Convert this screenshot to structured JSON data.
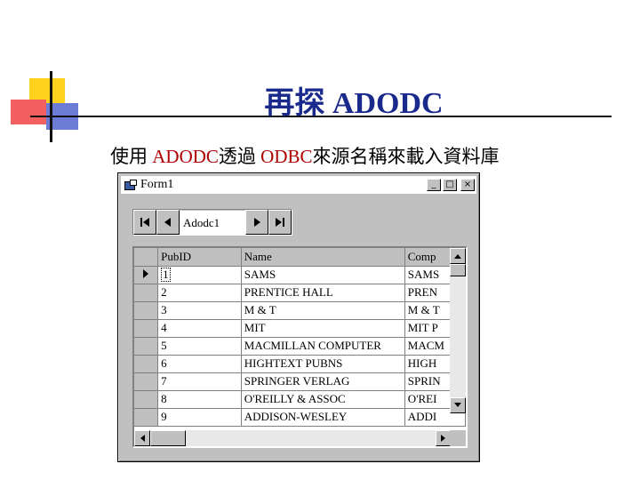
{
  "slide": {
    "title": "再探 ADODC",
    "subtitle_parts": [
      "使用 ",
      "ADODC",
      "透過 ",
      "ODBC",
      "來源名稱來載入資料庫"
    ]
  },
  "window": {
    "title": "Form1",
    "buttons": {
      "minimize": "_",
      "maximize": "□",
      "close": "×"
    }
  },
  "adodc": {
    "caption": "Adodc1"
  },
  "grid": {
    "columns": [
      "PubID",
      "Name",
      "Comp"
    ],
    "current_row": 0,
    "rows": [
      {
        "pubid": "1",
        "name": "SAMS",
        "comp": "SAMS"
      },
      {
        "pubid": "2",
        "name": "PRENTICE HALL",
        "comp": "PREN"
      },
      {
        "pubid": "3",
        "name": "M & T",
        "comp": "M & T"
      },
      {
        "pubid": "4",
        "name": "MIT",
        "comp": "MIT P"
      },
      {
        "pubid": "5",
        "name": "MACMILLAN COMPUTER",
        "comp": "MACM"
      },
      {
        "pubid": "6",
        "name": "HIGHTEXT PUBNS",
        "comp": "HIGH"
      },
      {
        "pubid": "7",
        "name": "SPRINGER VERLAG",
        "comp": "SPRIN"
      },
      {
        "pubid": "8",
        "name": "O'REILLY & ASSOC",
        "comp": "O'REI"
      },
      {
        "pubid": "9",
        "name": "ADDISON-WESLEY",
        "comp": "ADDI"
      }
    ]
  },
  "colors": {
    "title": "#1a2a8c",
    "highlight": "#b00000",
    "face": "#c0c0c0"
  },
  "icons": [
    "first-record-icon",
    "prev-record-icon",
    "next-record-icon",
    "last-record-icon",
    "current-row-arrow-icon",
    "scroll-up-icon",
    "scroll-down-icon",
    "scroll-left-icon",
    "scroll-right-icon"
  ]
}
